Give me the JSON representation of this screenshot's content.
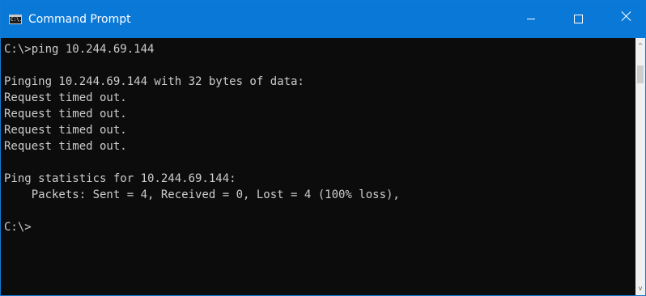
{
  "window": {
    "title": "Command Prompt",
    "app_icon": "cmd-icon",
    "app_icon_glyph": "C:\\."
  },
  "console": {
    "lines": [
      "C:\\>ping 10.244.69.144",
      "",
      "Pinging 10.244.69.144 with 32 bytes of data:",
      "Request timed out.",
      "Request timed out.",
      "Request timed out.",
      "Request timed out.",
      "",
      "Ping statistics for 10.244.69.144:",
      "    Packets: Sent = 4, Received = 0, Lost = 4 (100% loss),",
      "",
      "C:\\>"
    ]
  },
  "titlebar_buttons": {
    "minimize": "minimize-icon",
    "maximize": "maximize-icon",
    "close": "close-icon"
  },
  "scrollbar": {
    "up_glyph": "^",
    "down_glyph": "v"
  },
  "colors": {
    "titlebar": "#0a78d7",
    "console_bg": "#0c0c0c",
    "console_text": "#cccccc"
  }
}
